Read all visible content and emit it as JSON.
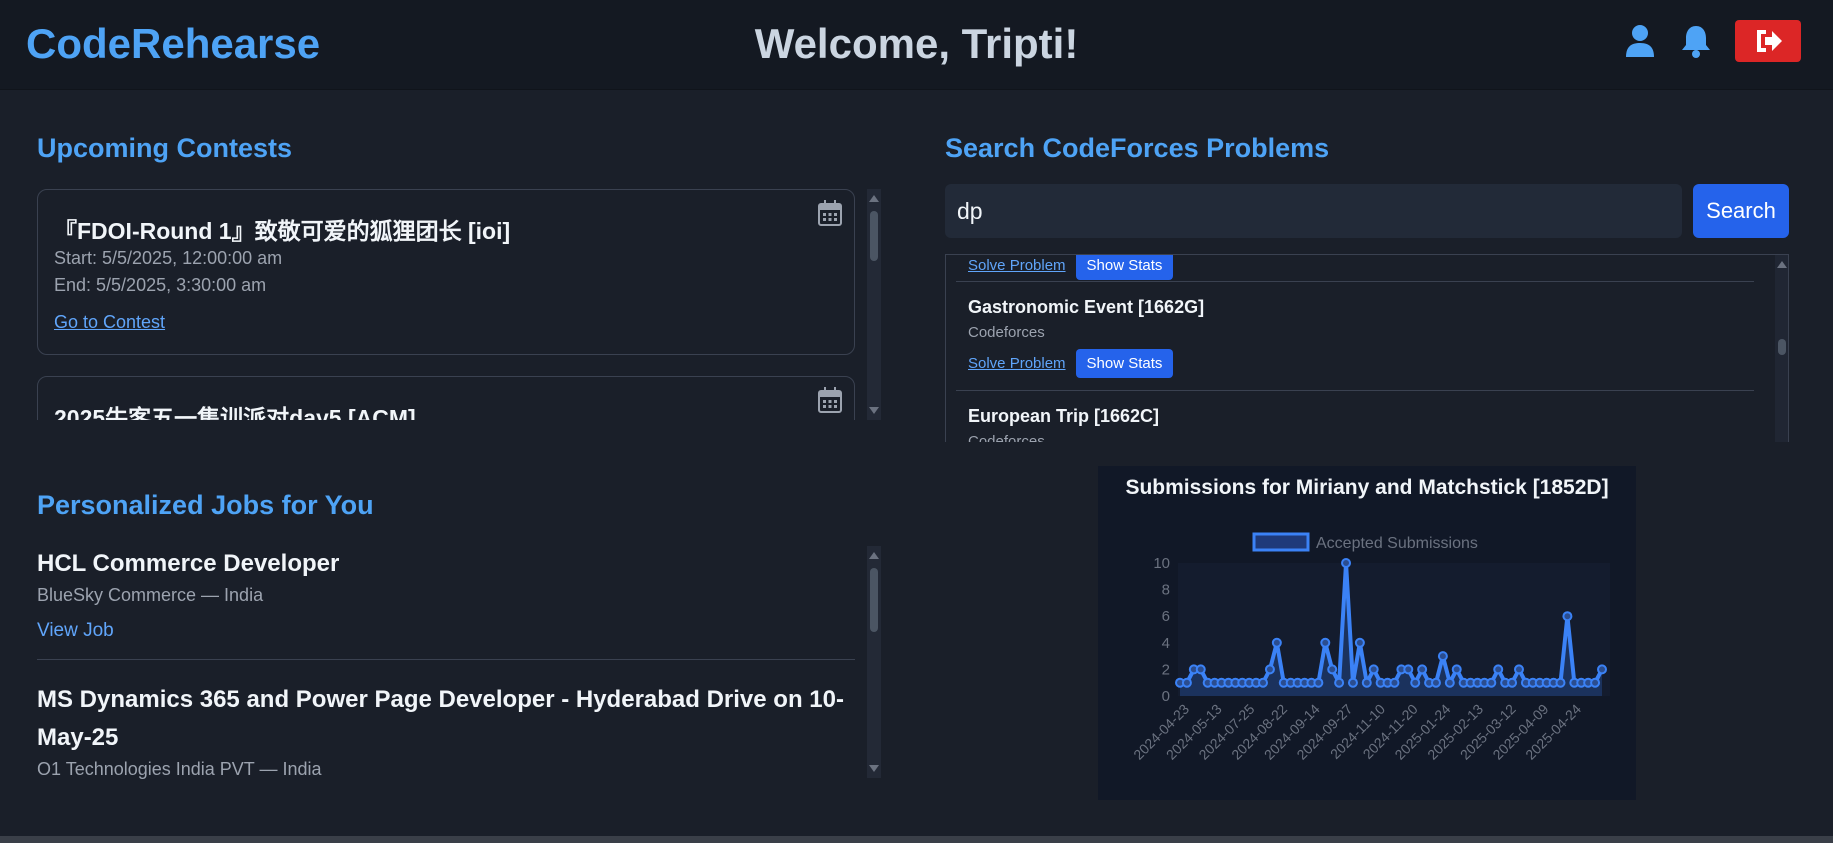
{
  "header": {
    "brand": "CodeRehearse",
    "welcome": "Welcome, Tripti!",
    "icons": [
      "user-icon",
      "bell-icon",
      "logout-icon"
    ],
    "accent_color": "#4ea3f5",
    "logout_color": "#dc2626"
  },
  "contests": {
    "title": "Upcoming Contests",
    "items": [
      {
        "name": "『FDOI-Round 1』致敬可爱的狐狸团长 [ioi]",
        "start": "Start: 5/5/2025, 12:00:00 am",
        "end": "End: 5/5/2025, 3:30:00 am",
        "link": "Go to Contest"
      },
      {
        "name": "2025牛客五一集训派对day5 [ACM]"
      }
    ]
  },
  "jobs": {
    "title": "Personalized Jobs for You",
    "items": [
      {
        "title": "HCL Commerce Developer",
        "company": "BlueSky Commerce — India",
        "link": "View Job"
      },
      {
        "title": "MS Dynamics 365 and Power Page Developer - Hyderabad Drive on 10-May-25",
        "company": "O1 Technologies India PVT — India"
      }
    ]
  },
  "search": {
    "title": "Search CodeForces Problems",
    "query": "dp",
    "button": "Search",
    "results": [
      {
        "solve": "Solve Problem",
        "stats": "Show Stats"
      },
      {
        "name": "Gastronomic Event [1662G]",
        "source": "Codeforces",
        "solve": "Solve Problem",
        "stats": "Show Stats"
      },
      {
        "name": "European Trip [1662C]",
        "source": "Codeforces"
      }
    ]
  },
  "chart_data": {
    "type": "line",
    "title": "Submissions for Miriany and Matchstick [1852D]",
    "series": [
      {
        "name": "Accepted Submissions",
        "color": "#3b82f6",
        "values": [
          1,
          1,
          2,
          2,
          1,
          1,
          1,
          1,
          1,
          1,
          1,
          1,
          1,
          2,
          4,
          1,
          1,
          1,
          1,
          1,
          1,
          4,
          2,
          1,
          10,
          1,
          4,
          1,
          2,
          1,
          1,
          1,
          2,
          2,
          1,
          2,
          1,
          1,
          3,
          1,
          2,
          1,
          1,
          1,
          1,
          1,
          2,
          1,
          1,
          2,
          1,
          1,
          1,
          1,
          1,
          1,
          6,
          1,
          1,
          1,
          1,
          2
        ]
      }
    ],
    "x_tick_labels": [
      "2024-04-23",
      "2024-05-13",
      "2024-07-25",
      "2024-08-22",
      "2024-09-14",
      "2024-09-27",
      "2024-11-10",
      "2024-11-20",
      "2025-01-24",
      "2025-02-13",
      "2025-03-12",
      "2025-04-09",
      "2025-04-24"
    ],
    "y_ticks": [
      0,
      2,
      4,
      6,
      8,
      10
    ],
    "ylim": [
      0,
      10
    ],
    "legend_position": "top",
    "fill": true
  }
}
